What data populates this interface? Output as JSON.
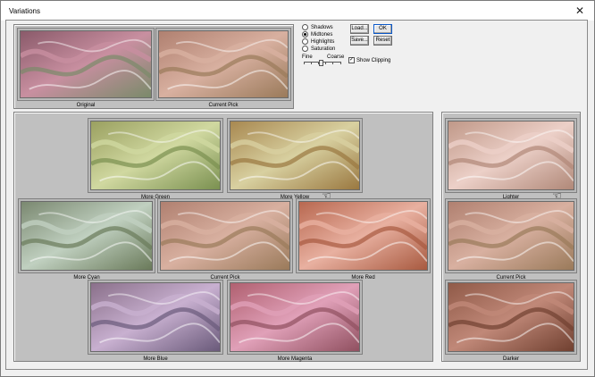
{
  "window": {
    "title": "Variations",
    "close_glyph": "✕"
  },
  "top": {
    "original_label": "Original",
    "current_pick_label": "Current Pick"
  },
  "options": {
    "radios": [
      {
        "label": "Shadows",
        "selected": false
      },
      {
        "label": "Midtones",
        "selected": true
      },
      {
        "label": "Highlights",
        "selected": false
      },
      {
        "label": "Saturation",
        "selected": false
      }
    ],
    "buttons": {
      "load": "Load...",
      "save": "Save...",
      "ok": "OK",
      "reset": "Reset"
    },
    "fine_label": "Fine",
    "coarse_label": "Coarse",
    "show_clipping_label": "Show Clipping",
    "show_clipping_checked": true,
    "check_glyph": "✓"
  },
  "color_grid": {
    "more_green": "More Green",
    "more_yellow": "More Yellow",
    "more_cyan": "More Cyan",
    "current_pick": "Current Pick",
    "more_red": "More Red",
    "more_blue": "More Blue",
    "more_magenta": "More Magenta"
  },
  "brightness": {
    "lighter": "Lighter",
    "current_pick": "Current Pick",
    "darker": "Darker"
  },
  "tints": {
    "original": [
      "#8a5a6a",
      "#c88fa0",
      "#7a8a6a"
    ],
    "current_pick": [
      "#b08070",
      "#d8b0a0",
      "#9a7a5a"
    ],
    "more_green": [
      "#9aa060",
      "#d0d8a0",
      "#7a9050"
    ],
    "more_yellow": [
      "#a88850",
      "#d8d0a0",
      "#9a7840"
    ],
    "more_cyan": [
      "#7a8870",
      "#c0d0c0",
      "#6a7a5a"
    ],
    "more_red": [
      "#b86850",
      "#e8b0a0",
      "#a85a40"
    ],
    "more_blue": [
      "#8a708a",
      "#c8b0d0",
      "#6a5a7a"
    ],
    "more_magenta": [
      "#b06070",
      "#e0a0b8",
      "#905060"
    ],
    "lighter": [
      "#c09888",
      "#ecd0c8",
      "#b08878"
    ],
    "darker": [
      "#905a48",
      "#c08878",
      "#704030"
    ]
  },
  "cursor_glyph": "☜"
}
